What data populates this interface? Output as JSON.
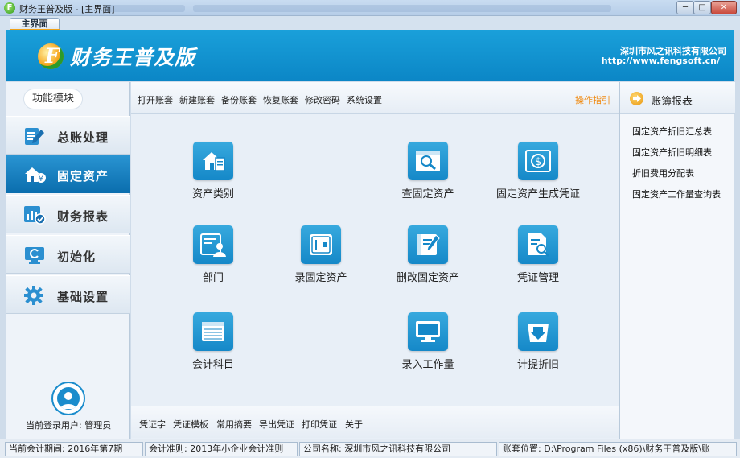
{
  "window": {
    "title": "财务王普及版 - [主界面]",
    "app_icon_glyph": "F",
    "controls": {
      "minimize": "─",
      "maximize": "□",
      "close": "✕"
    }
  },
  "tabs": [
    {
      "label": "主界面",
      "active": true
    }
  ],
  "banner": {
    "logo_glyph": "F",
    "product_name": "财务王普及版",
    "company": "深圳市风之讯科技有限公司",
    "url": "http://www.fengsoft.cn/"
  },
  "sidebar": {
    "section_label": "功能模块",
    "items": [
      {
        "label": "总账处理",
        "icon": "ledger-pen-icon",
        "active": false
      },
      {
        "label": "固定资产",
        "icon": "asset-house-icon",
        "active": true
      },
      {
        "label": "财务报表",
        "icon": "report-chart-icon",
        "active": false
      },
      {
        "label": "初始化",
        "icon": "monitor-reset-icon",
        "active": false
      },
      {
        "label": "基础设置",
        "icon": "gear-icon",
        "active": false
      }
    ],
    "user_label": "当前登录用户: 管理员"
  },
  "toolbar": {
    "items": [
      "打开账套",
      "新建账套",
      "备份账套",
      "恢复账套",
      "修改密码",
      "系统设置"
    ],
    "guide": "操作指引"
  },
  "functions": [
    {
      "label": "资产类别",
      "icon": "house-document-icon"
    },
    {
      "label": "查固定资产",
      "icon": "search-document-icon"
    },
    {
      "label": "固定资产生成凭证",
      "icon": "dollar-voucher-icon"
    },
    {
      "label": "部门",
      "icon": "department-user-icon"
    },
    {
      "label": "录固定资产",
      "icon": "safe-box-icon"
    },
    {
      "label": "删改固定资产",
      "icon": "notebook-pencil-icon"
    },
    {
      "label": "凭证管理",
      "icon": "voucher-search-icon"
    },
    {
      "label": "会计科目",
      "icon": "account-book-icon"
    },
    {
      "label": "录入工作量",
      "icon": "monitor-icon"
    },
    {
      "label": "计提折旧",
      "icon": "download-box-icon"
    }
  ],
  "bottom_bar": {
    "items": [
      "凭证字",
      "凭证模板",
      "常用摘要",
      "导出凭证",
      "打印凭证",
      "关于"
    ]
  },
  "right_panel": {
    "title": "账簿报表",
    "links": [
      "固定资产折旧汇总表",
      "固定资产折旧明细表",
      "折旧费用分配表",
      "固定资产工作量查询表"
    ]
  },
  "status": {
    "period": "当前会计期间: 2016年第7期",
    "standard": "会计准则: 2013年小企业会计准则",
    "company": "公司名称: 深圳市风之讯科技有限公司",
    "location": "账套位置: D:\\Program Files (x86)\\财务王普及版\\账"
  },
  "colors": {
    "banner": "#0b86c6",
    "active_nav": "#0b6eae",
    "icon_tile": "#1588c8",
    "guide_text": "#f08a10"
  }
}
